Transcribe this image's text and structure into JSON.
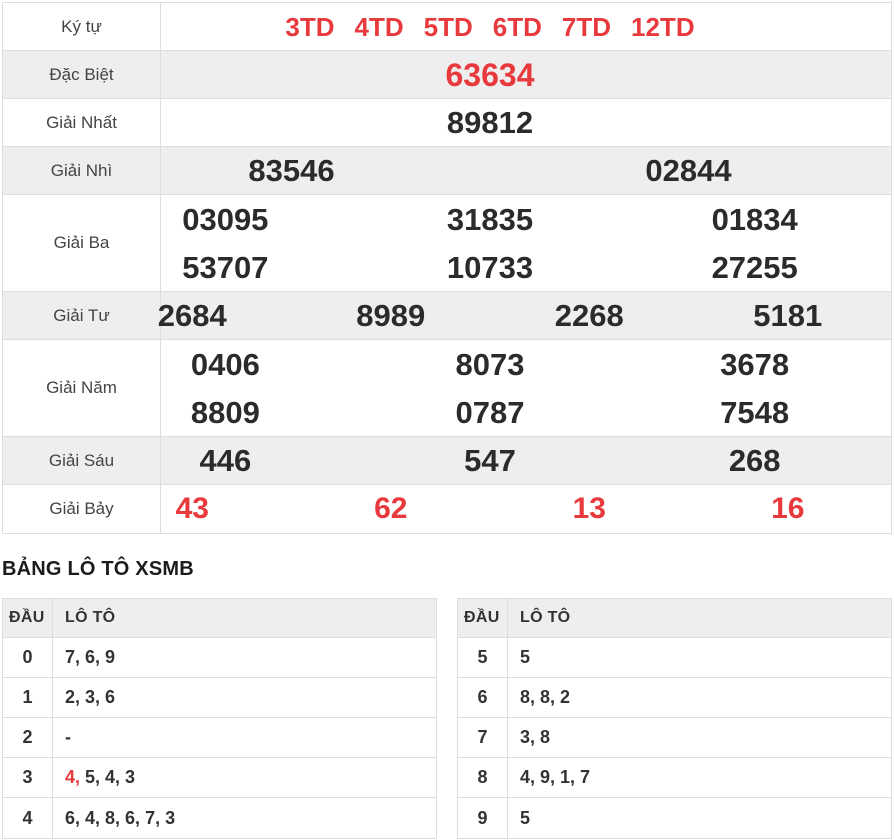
{
  "prize_table": {
    "rows": [
      {
        "label": "Ký tự",
        "kind": "symbols",
        "color": "red",
        "lines": [
          [
            "3TD",
            "4TD",
            "5TD",
            "6TD",
            "7TD",
            "12TD"
          ]
        ]
      },
      {
        "label": "Đặc Biệt",
        "kind": "special",
        "color": "red",
        "lines": [
          [
            "63634"
          ]
        ]
      },
      {
        "label": "Giải Nhất",
        "kind": "normal",
        "lines": [
          [
            "89812"
          ]
        ]
      },
      {
        "label": "Giải Nhì",
        "kind": "normal",
        "lines": [
          [
            "83546",
            "02844"
          ]
        ]
      },
      {
        "label": "Giải Ba",
        "kind": "normal",
        "lines": [
          [
            "03095",
            "31835",
            "01834"
          ],
          [
            "53707",
            "10733",
            "27255"
          ]
        ]
      },
      {
        "label": "Giải Tư",
        "kind": "normal",
        "lines": [
          [
            "2684",
            "8989",
            "2268",
            "5181"
          ]
        ]
      },
      {
        "label": "Giải Năm",
        "kind": "normal",
        "lines": [
          [
            "0406",
            "8073",
            "3678"
          ],
          [
            "8809",
            "0787",
            "7548"
          ]
        ]
      },
      {
        "label": "Giải Sáu",
        "kind": "normal",
        "lines": [
          [
            "446",
            "547",
            "268"
          ]
        ]
      },
      {
        "label": "Giải Bảy",
        "kind": "seventh",
        "color": "red",
        "lines": [
          [
            "43",
            "62",
            "13",
            "16"
          ]
        ]
      }
    ]
  },
  "loto_section": {
    "title": "BẢNG LÔ TÔ XSMB",
    "col_headers": [
      "ĐẦU",
      "LÔ TÔ"
    ],
    "left_table": {
      "rows": [
        {
          "dau": "0",
          "values": [
            "7",
            "6",
            "9"
          ]
        },
        {
          "dau": "1",
          "values": [
            "2",
            "3",
            "6"
          ]
        },
        {
          "dau": "2",
          "values": [
            "-"
          ]
        },
        {
          "dau": "3",
          "values": [
            "4",
            "5",
            "4",
            "3"
          ],
          "red_indices": [
            0
          ]
        },
        {
          "dau": "4",
          "values": [
            "6",
            "4",
            "8",
            "6",
            "7",
            "3"
          ]
        }
      ]
    },
    "right_table": {
      "rows": [
        {
          "dau": "5",
          "values": [
            "5"
          ]
        },
        {
          "dau": "6",
          "values": [
            "8",
            "8",
            "2"
          ]
        },
        {
          "dau": "7",
          "values": [
            "3",
            "8"
          ]
        },
        {
          "dau": "8",
          "values": [
            "4",
            "9",
            "1",
            "7"
          ]
        },
        {
          "dau": "9",
          "values": [
            "5"
          ]
        }
      ]
    }
  },
  "colors": {
    "accent_red": "#e8393d",
    "number_black": "#2b2b2b",
    "row_gray": "#eeeeee",
    "border": "#dddddd"
  }
}
